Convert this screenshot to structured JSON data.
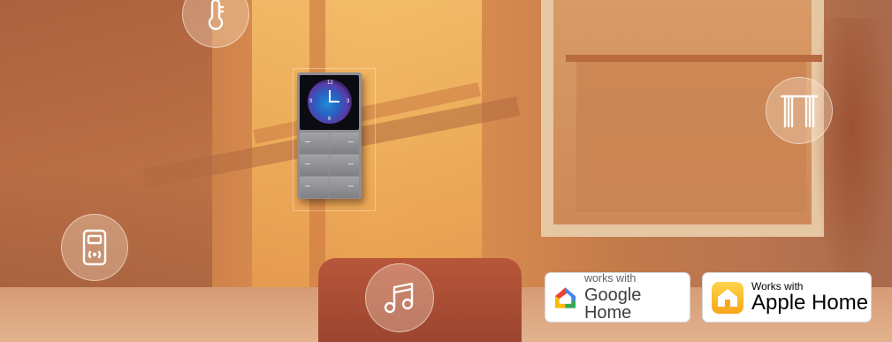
{
  "badges": {
    "google": {
      "small": "works with",
      "big": "Google Home"
    },
    "apple": {
      "small": "Works with",
      "big": "Apple Home"
    }
  },
  "device": {
    "clock_numerals": [
      "12",
      "3",
      "6",
      "9"
    ]
  },
  "icons": [
    "thermometer-icon",
    "curtain-icon",
    "remote-meter-icon",
    "music-note-icon",
    "google-home-icon",
    "apple-home-icon"
  ],
  "colors": {
    "google_red": "#ea4335",
    "google_blue": "#4285f4",
    "google_green": "#34a853",
    "google_yellow": "#fbbc04",
    "apple_yellow": "#f7a51b"
  }
}
